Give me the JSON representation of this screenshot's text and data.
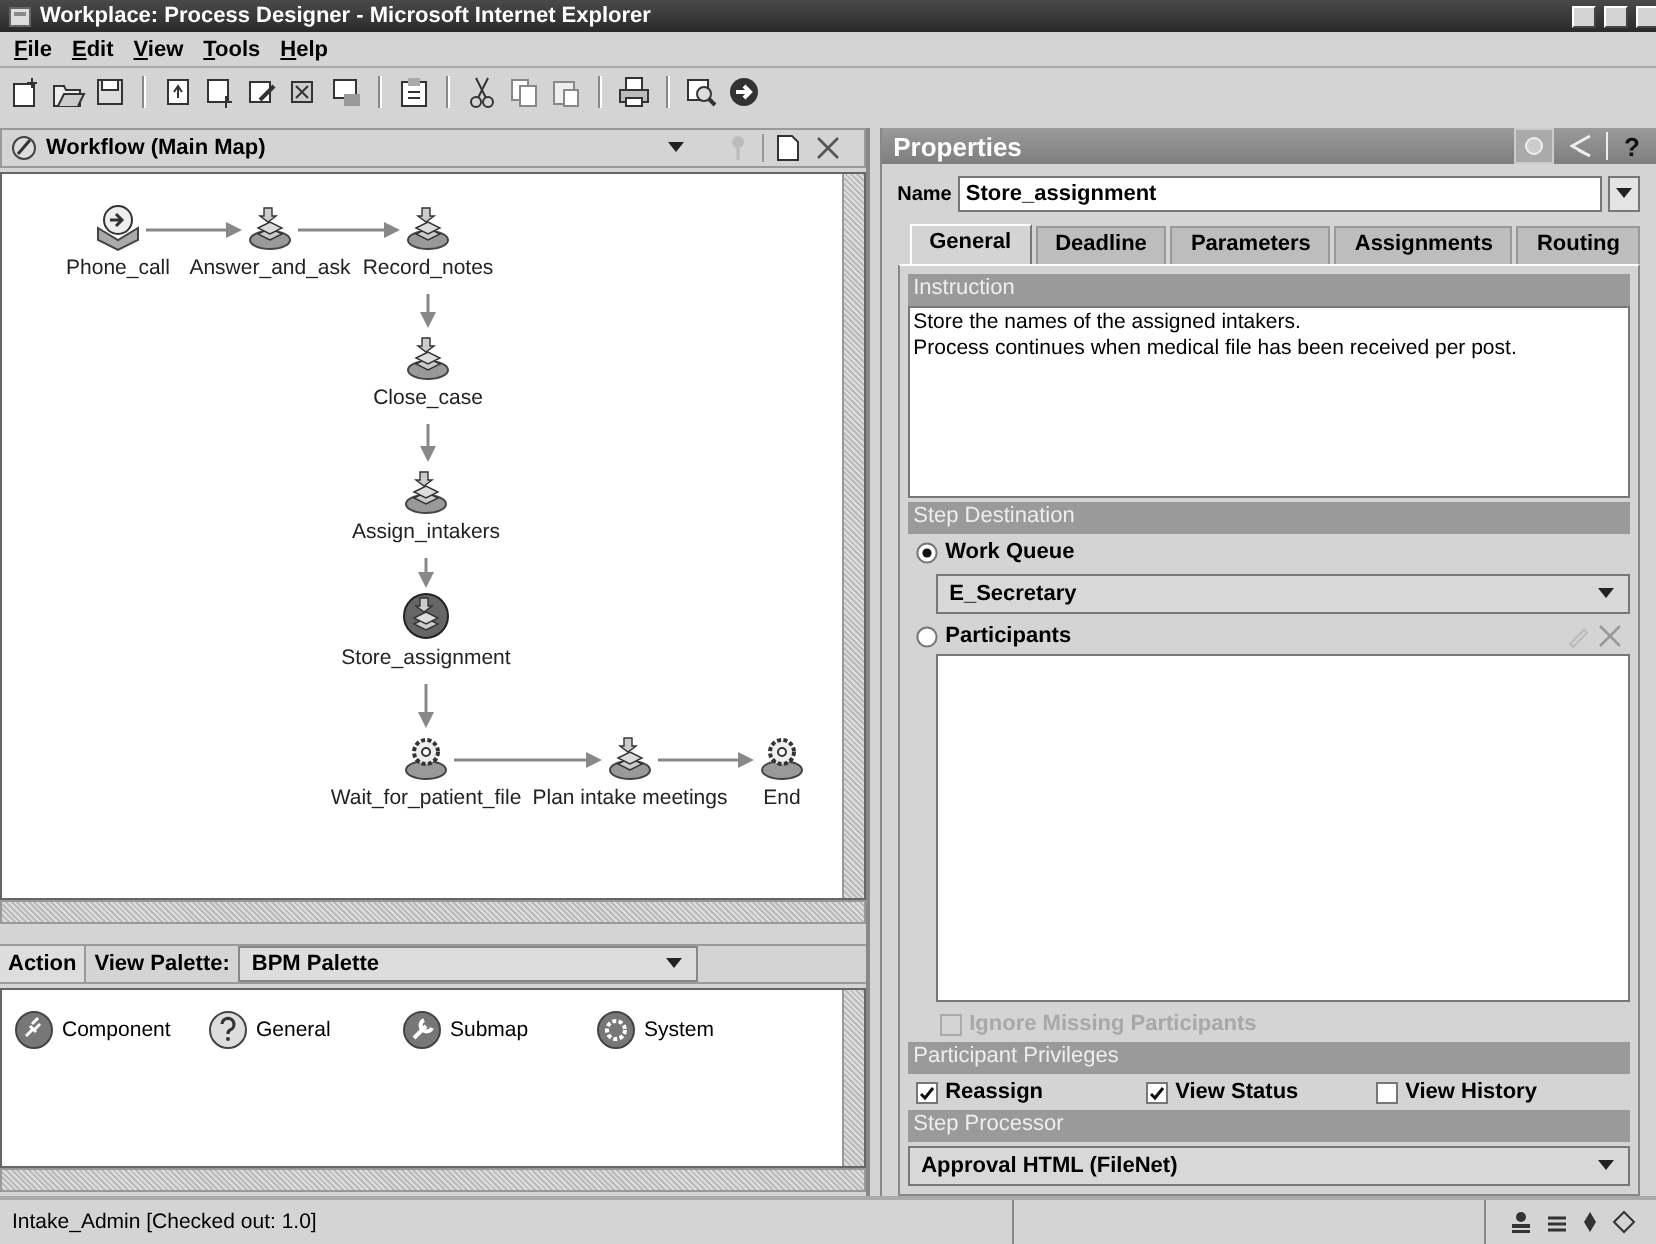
{
  "window": {
    "title": "Workplace: Process Designer - Microsoft Internet Explorer"
  },
  "menu": [
    {
      "label": "File"
    },
    {
      "label": "Edit"
    },
    {
      "label": "View"
    },
    {
      "label": "Tools"
    },
    {
      "label": "Help"
    }
  ],
  "map_panel": {
    "title": "Workflow (Main Map)",
    "nodes": [
      {
        "label": "Phone_call",
        "kind": "launch",
        "selected": false
      },
      {
        "label": "Answer_and_ask",
        "kind": "step",
        "selected": false
      },
      {
        "label": "Record_notes",
        "kind": "step",
        "selected": false
      },
      {
        "label": "Close_case",
        "kind": "step",
        "selected": false
      },
      {
        "label": "Assign_intakers",
        "kind": "step",
        "selected": false
      },
      {
        "label": "Store_assignment",
        "kind": "step",
        "selected": true
      },
      {
        "label": "Wait_for_patient_file",
        "kind": "system",
        "selected": false
      },
      {
        "label": "Plan intake meetings",
        "kind": "step",
        "selected": false
      },
      {
        "label": "End",
        "kind": "system",
        "selected": false
      }
    ]
  },
  "palette": {
    "action": "Action",
    "view_label": "View Palette:",
    "value": "BPM Palette",
    "items": [
      {
        "label": "Component",
        "kind": "component"
      },
      {
        "label": "General",
        "kind": "general"
      },
      {
        "label": "Submap",
        "kind": "submap"
      },
      {
        "label": "System",
        "kind": "system"
      }
    ]
  },
  "properties": {
    "title": "Properties",
    "help": "?",
    "name_label": "Name",
    "name_value": "Store_assignment",
    "tabs": [
      {
        "label": "General",
        "selected": true
      },
      {
        "label": "Deadline",
        "selected": false
      },
      {
        "label": "Parameters",
        "selected": false
      },
      {
        "label": "Assignments",
        "selected": false
      },
      {
        "label": "Routing",
        "selected": false
      }
    ],
    "instruction": {
      "header": "Instruction",
      "text": "Store the names of the assigned intakers.\nProcess continues when medical file has been received per post."
    },
    "step_destination": {
      "header": "Step Destination",
      "options": [
        {
          "label": "Work Queue",
          "selected": true
        },
        {
          "label": "Participants",
          "selected": false
        }
      ],
      "queue": "E_Secretary",
      "ignore": {
        "label": "Ignore Missing Participants",
        "checked": false,
        "disabled": true
      }
    },
    "privileges": {
      "header": "Participant Privileges",
      "items": [
        {
          "label": "Reassign",
          "checked": true
        },
        {
          "label": "View Status",
          "checked": true
        },
        {
          "label": "View History",
          "checked": false
        }
      ]
    },
    "processor": {
      "header": "Step Processor",
      "value": "Approval HTML (FileNet)"
    }
  },
  "status_bar": {
    "text": "Intake_Admin [Checked out: 1.0]"
  }
}
